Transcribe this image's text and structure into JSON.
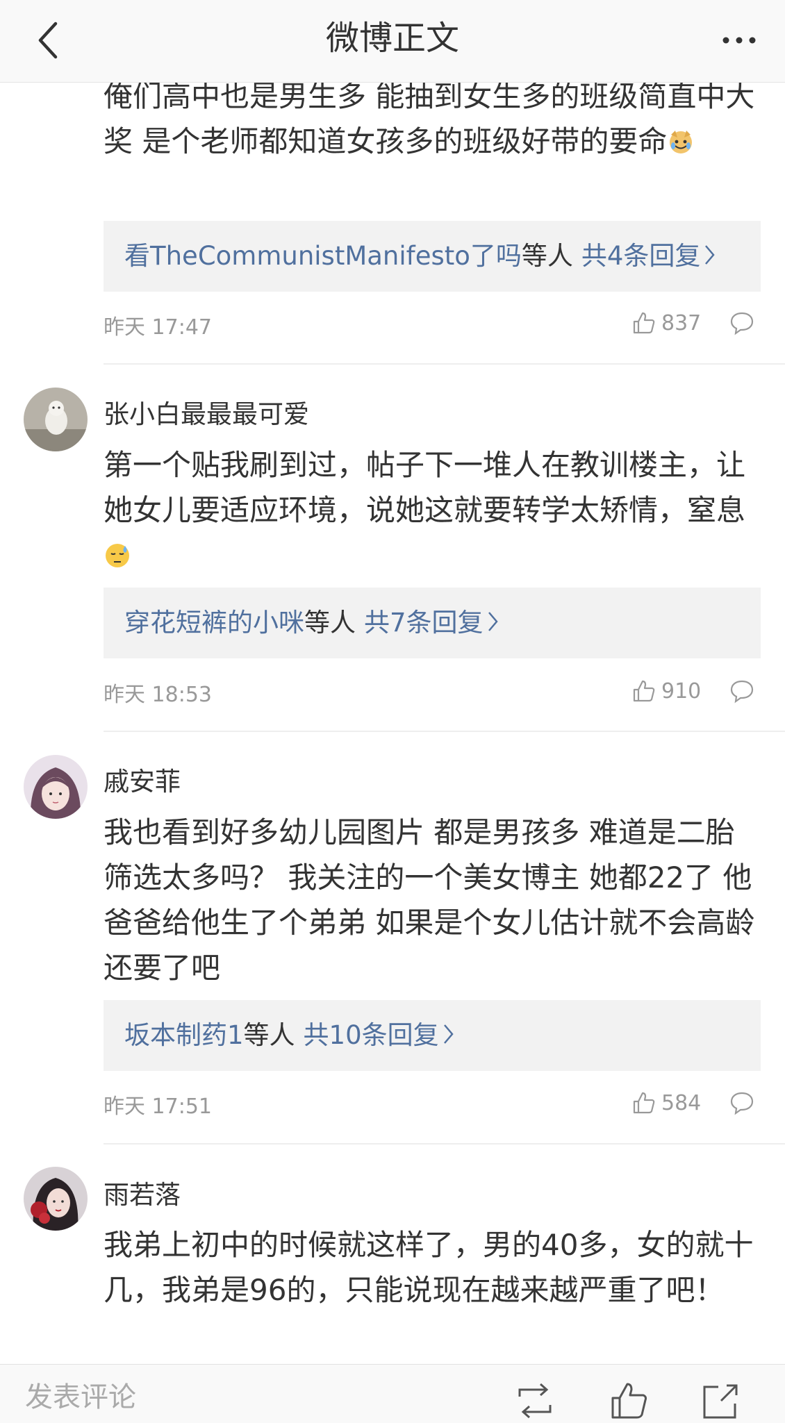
{
  "header": {
    "title": "微博正文"
  },
  "comments": [
    {
      "text": "俺们高中也是男生多 能抽到女生多的班级简直中大奖 是个老师都知道女孩多的班级好带的要命",
      "emoji": "cry-laugh-dog-emoji",
      "replies": {
        "names": "看TheCommunistManifesto了吗",
        "middle": "等人",
        "count": "共4条回复"
      },
      "time": "昨天 17:47",
      "likes": "837"
    },
    {
      "username": "张小白最最最可爱",
      "text": "第一个贴我刷到过，帖子下一堆人在教训楼主，让她女儿要适应环境，说她这就要转学太矫情，窒息",
      "emoji": "sweat-emoji",
      "replies": {
        "names": "穿花短裤的小咪",
        "middle": "等人",
        "count": "共7条回复"
      },
      "time": "昨天 18:53",
      "likes": "910"
    },
    {
      "username": "戚安菲",
      "text": "我也看到好多幼儿园图片 都是男孩多 难道是二胎筛选太多吗？ 我关注的一个美女博主 她都22了 他爸爸给他生了个弟弟 如果是个女儿估计就不会高龄还要了吧",
      "replies": {
        "names": "坂本制药1",
        "middle": "等人",
        "count": "共10条回复"
      },
      "time": "昨天 17:51",
      "likes": "584"
    },
    {
      "username": "雨若落",
      "text": "我弟上初中的时候就这样了，男的40多，女的就十几，我弟是96的，只能说现在越来越严重了吧！"
    }
  ],
  "bottombar": {
    "compose_placeholder": "发表评论"
  }
}
